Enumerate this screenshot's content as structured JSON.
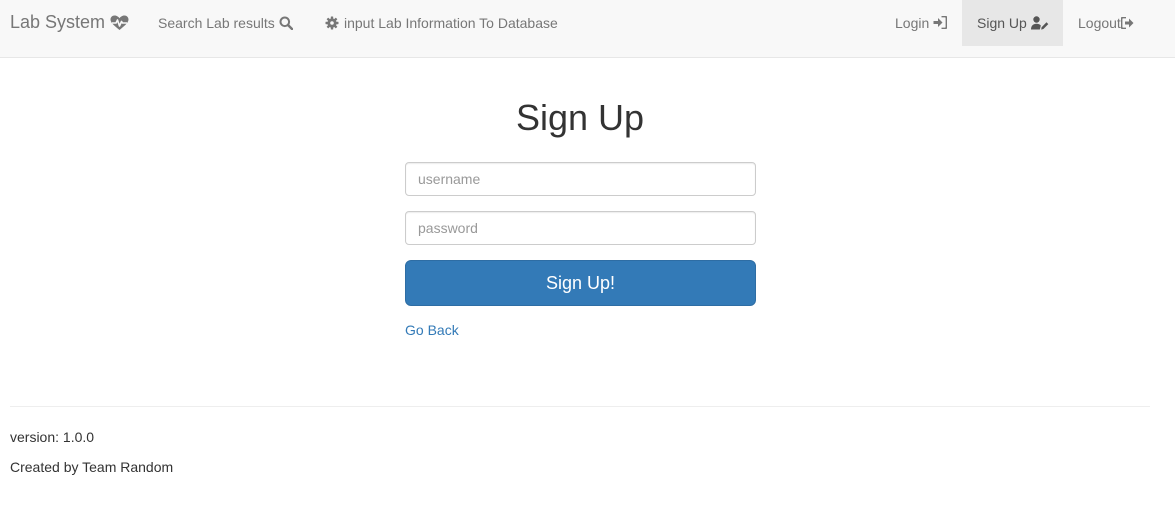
{
  "navbar": {
    "brand": {
      "label": "Lab System",
      "icon": "heartbeat-icon"
    },
    "links": {
      "search": {
        "label": "Search Lab results",
        "icon": "search-icon"
      },
      "input": {
        "label": "input Lab Information To Database",
        "icon": "gear-icon"
      },
      "login": {
        "label": "Login",
        "icon": "sign-in-icon"
      },
      "signup": {
        "label": "Sign Up",
        "icon": "user-edit-icon",
        "active": true
      },
      "logout": {
        "label": "Logout",
        "icon": "sign-out-icon"
      }
    }
  },
  "form": {
    "title": "Sign Up",
    "username": {
      "placeholder": "username",
      "value": ""
    },
    "password": {
      "placeholder": "password",
      "value": ""
    },
    "submit_label": "Sign Up!",
    "back_label": "Go Back"
  },
  "footer": {
    "version": "version: 1.0.0",
    "credit": "Created by Team Random"
  },
  "colors": {
    "navbar_bg": "#f8f8f8",
    "active_nav_bg": "#e7e7e7",
    "primary": "#337ab7",
    "link": "#337ab7",
    "nav_text": "#777777"
  }
}
